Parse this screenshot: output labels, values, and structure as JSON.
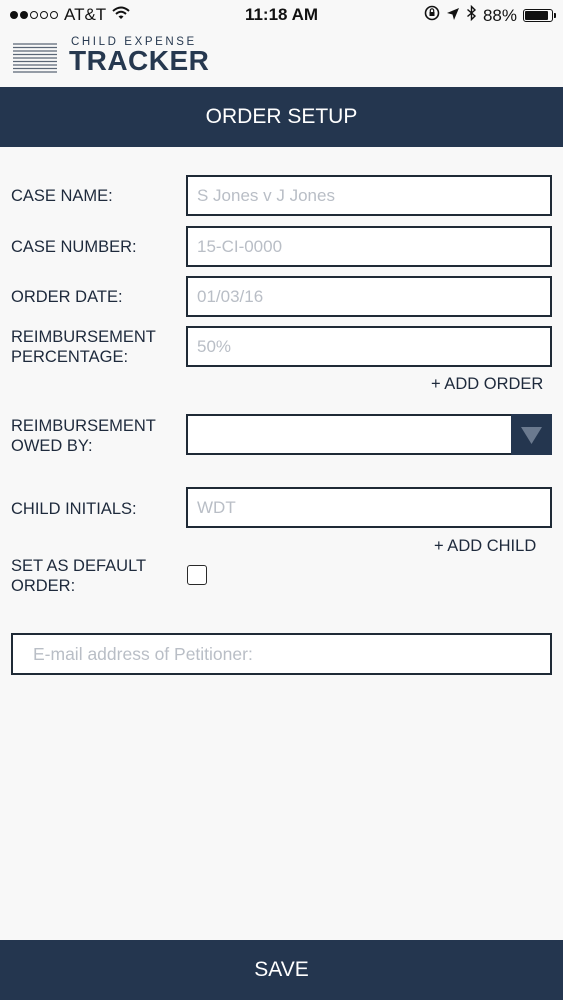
{
  "status_bar": {
    "carrier": "AT&T",
    "time": "11:18 AM",
    "battery_percent": "88%",
    "battery_level": 0.88,
    "signal_dots_filled": 2,
    "signal_dots_total": 5,
    "icons": [
      "wifi-icon",
      "orientation-lock-icon",
      "location-arrow-icon",
      "bluetooth-icon",
      "battery-icon"
    ]
  },
  "header": {
    "logo_top": "CHILD EXPENSE",
    "logo_bottom": "TRACKER",
    "menu_icon": "hamburger-menu-icon"
  },
  "page_title": "ORDER SETUP",
  "form": {
    "case_name": {
      "label": "CASE NAME:",
      "value": "",
      "placeholder": "S Jones v J Jones"
    },
    "case_number": {
      "label": "CASE NUMBER:",
      "value": "",
      "placeholder": "15-CI-0000"
    },
    "order_date": {
      "label": "ORDER DATE:",
      "value": "",
      "placeholder": "01/03/16"
    },
    "reimbursement_percentage": {
      "label_line1": "REIMBURSEMENT",
      "label_line2": "PERCENTAGE:",
      "value": "",
      "placeholder": "50%"
    },
    "add_order": "+ ADD ORDER",
    "reimbursement_owed_by": {
      "label_line1": "REIMBURSEMENT",
      "label_line2": "OWED BY:",
      "selected": ""
    },
    "child_initials": {
      "label": "CHILD INITIALS:",
      "value": "",
      "placeholder": "WDT"
    },
    "add_child": "+ ADD CHILD",
    "default_order": {
      "label_line1": "SET AS DEFAULT",
      "label_line2": "ORDER:",
      "checked": false
    },
    "email": {
      "value": "",
      "placeholder": "E-mail address of Petitioner:"
    }
  },
  "save_label": "SAVE",
  "colors": {
    "navy": "#24364f",
    "background": "#f8f8f8",
    "placeholder": "#b9bec6"
  }
}
